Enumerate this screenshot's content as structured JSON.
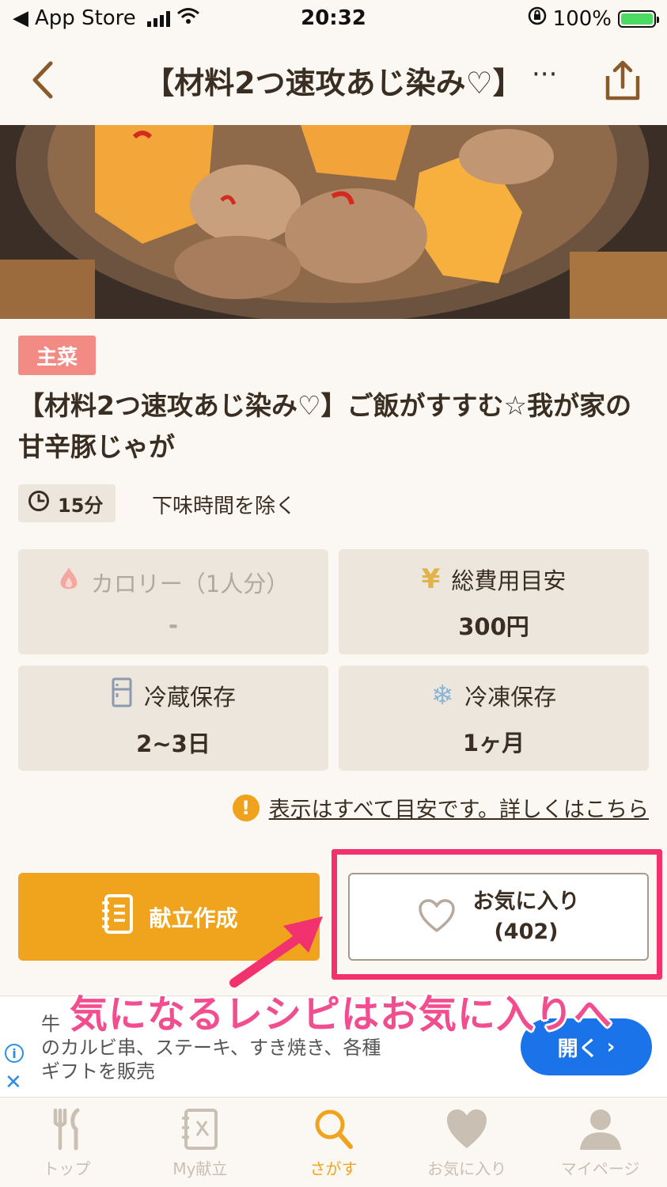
{
  "status_bar": {
    "back_app": "App Store",
    "time": "20:32",
    "battery": "100%"
  },
  "nav": {
    "title": "【材料2つ速攻あじ染み♡】",
    "more": "···"
  },
  "recipe": {
    "tag": "主菜",
    "title": "【材料2つ速攻あじ染み♡】ご飯がすすむ☆我が家の甘辛豚じゃが",
    "time": "15分",
    "time_note": "下味時間を除く"
  },
  "info": {
    "calorie_label": "カロリー（1人分）",
    "calorie_value": "-",
    "cost_label": "総費用目安",
    "cost_value": "300円",
    "fridge_label": "冷蔵保存",
    "fridge_value": "2~3日",
    "freezer_label": "冷凍保存",
    "freezer_value": "1ヶ月"
  },
  "disclaimer": "表示はすべて目安です。詳しくはこちら",
  "actions": {
    "menu_label": "献立作成",
    "fav_label": "お気に入り",
    "fav_count": "(402)"
  },
  "ad": {
    "text_line1": "牛",
    "text_line2": "のカルビ串、ステーキ、すき焼き、各種",
    "text_line3": "ギフトを販売",
    "button": "開く"
  },
  "caption": "気になるレシピはお気に入りへ",
  "tabs": [
    {
      "label": "トップ"
    },
    {
      "label": "My献立"
    },
    {
      "label": "さがす"
    },
    {
      "label": "お気に入り"
    },
    {
      "label": "マイページ"
    }
  ],
  "colors": {
    "accent": "#f0a31d",
    "highlight": "#f2326e",
    "tag": "#f28b84"
  }
}
